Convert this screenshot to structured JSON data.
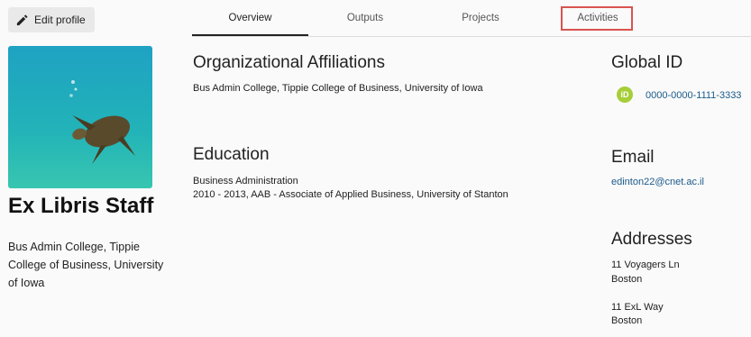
{
  "edit": {
    "label": "Edit profile"
  },
  "tabs": [
    {
      "label": "Overview"
    },
    {
      "label": "Outputs"
    },
    {
      "label": "Projects"
    },
    {
      "label": "Activities"
    }
  ],
  "profile": {
    "name": "Ex Libris Staff",
    "affiliation": "Bus Admin College, Tippie College of Business, University of Iowa"
  },
  "org": {
    "title": "Organizational Affiliations",
    "text": "Bus Admin College, Tippie College of Business, University of Iowa"
  },
  "education": {
    "title": "Education",
    "field": "Business Administration",
    "detail": "2010 - 2013, AAB - Associate of Applied Business, University of Stanton"
  },
  "global_id": {
    "title": "Global ID",
    "badge": "iD",
    "value": "0000-0000-1111-3333"
  },
  "email": {
    "title": "Email",
    "value": "edinton22@cnet.ac.il"
  },
  "addresses": {
    "title": "Addresses",
    "items": [
      {
        "line1": "11 Voyagers Ln",
        "line2": "Boston"
      },
      {
        "line1": "11 ExL Way",
        "line2": "Boston"
      }
    ]
  },
  "colors": {
    "accent_link": "#1a5a8a",
    "highlight": "#d9534f",
    "orcid": "#a6ce39"
  }
}
